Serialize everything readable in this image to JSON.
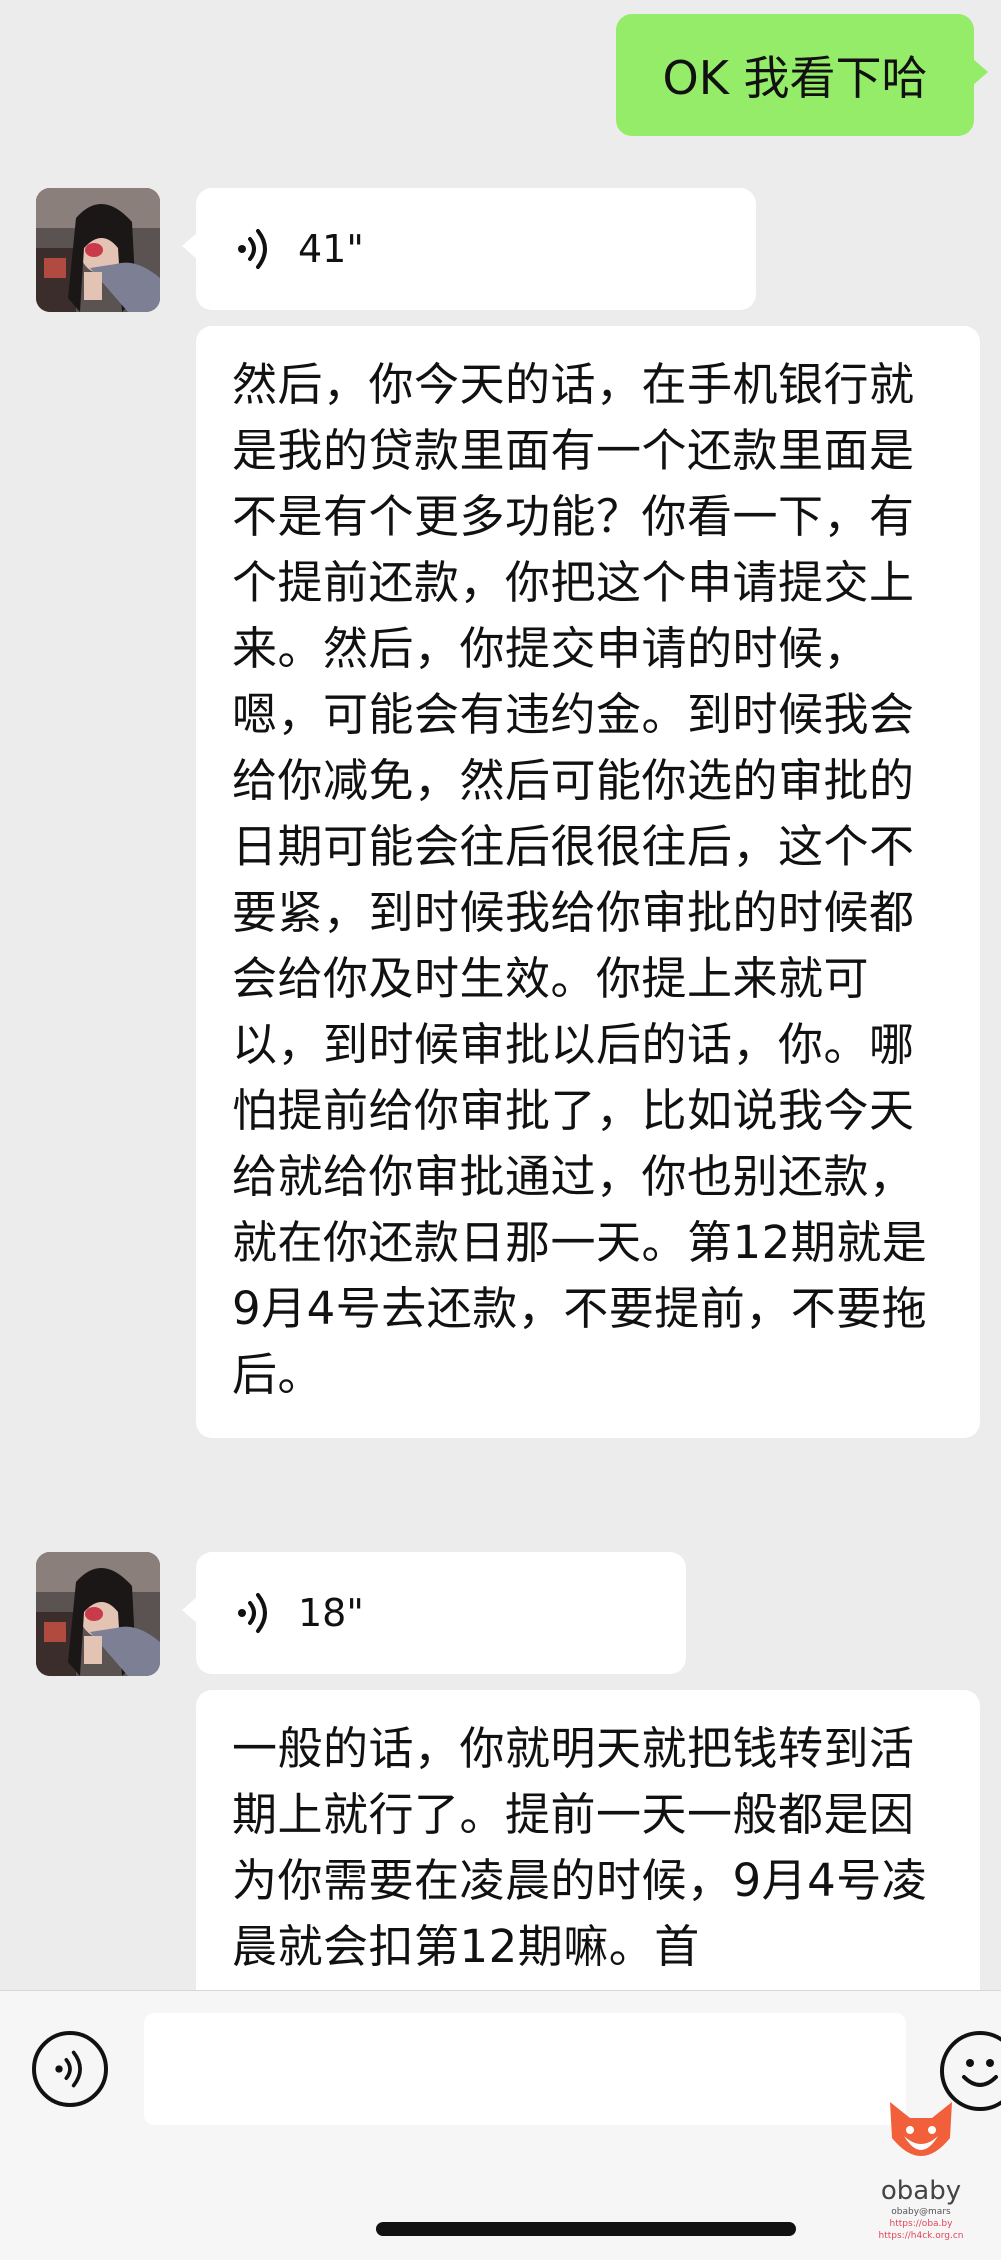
{
  "messages": {
    "outgoing_1": "OK 我看下哈",
    "voice_1_duration": "41\"",
    "text_1": "然后，你今天的话，在手机银行就是我的贷款里面有一个还款里面是不是有个更多功能？你看一下，有个提前还款，你把这个申请提交上来。然后，你提交申请的时候，嗯，可能会有违约金。到时候我会给你减免，然后可能你选的审批的日期可能会往后很很往后，这个不要紧，到时候我给你审批的时候都会给你及时生效。你提上来就可以，到时候审批以后的话，你。哪怕提前给你审批了，比如说我今天给就给你审批通过，你也别还款，就在你还款日那一天。第12期就是9月4号去还款，不要提前，不要拖后。",
    "voice_2_duration": "18\"",
    "text_2": "一般的话，你就明天就把钱转到活期上就行了。提前一天一般都是因为你需要在凌晨的时候，9月4号凌晨就会扣第12期嘛。首"
  },
  "watermark": {
    "name": "obaby",
    "sub": "obaby@mars",
    "url_1": "https://oba.by",
    "url_2": "https://h4ck.org.cn"
  },
  "colors": {
    "outgoing_bubble": "#95ec69",
    "incoming_bubble": "#ffffff",
    "background": "#ececec"
  },
  "icons": {
    "voice_wave": "voice-wave-icon",
    "voice_input": "voice-input-icon",
    "emoji": "emoji-icon"
  }
}
